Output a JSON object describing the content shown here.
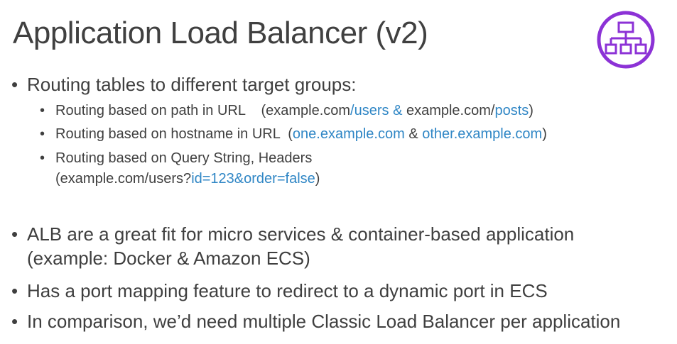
{
  "slide": {
    "title": "Application Load Balancer (v2)",
    "logo_icon": "load-balancer-icon",
    "accent_color": "#8c32d6",
    "link_color": "#2f86c5",
    "bullet_char": "•"
  },
  "bullets": {
    "routing_tables": "Routing tables to different target groups:",
    "path": {
      "prefix": "Routing based on path in URL    (example.com",
      "users": "/users &",
      "mid": " example.com/",
      "posts": "posts",
      "suffix": ")"
    },
    "hostname": {
      "prefix": "Routing based on hostname in URL  (",
      "one": "one.example.com",
      "mid": " & ",
      "other": "other.example.com",
      "suffix": ")"
    },
    "query": {
      "line1": "Routing based on Query String, Headers",
      "line2_prefix": "(example.com/users?",
      "line2_blue": "id=123&order=false",
      "line2_suffix": ")"
    },
    "alb_fit_line1": "ALB are a great fit for micro services & container-based application",
    "alb_fit_line2": "(example: Docker & Amazon ECS)",
    "port_mapping": "Has a port mapping feature to redirect to a dynamic port in ECS",
    "comparison": "In comparison, we’d need multiple Classic Load Balancer per application"
  }
}
